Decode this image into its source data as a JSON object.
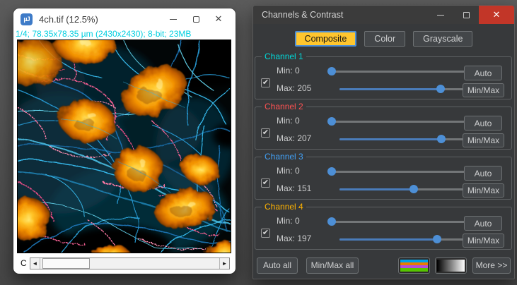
{
  "image_window": {
    "title": "4ch.tif (12.5%)",
    "info_line": "1/4; 78.35x78.35 µm (2430x2430); 8-bit; 23MB",
    "info_color": "#00cfe0",
    "channel_slider": {
      "label": "C",
      "position": "1/4"
    }
  },
  "channels_dialog": {
    "title": "Channels & Contrast",
    "accent_color": "#ffc62e",
    "slider_color": "#4d8fd6",
    "display_modes": [
      {
        "label": "Composite",
        "selected": true
      },
      {
        "label": "Color",
        "selected": false
      },
      {
        "label": "Grayscale",
        "selected": false
      }
    ],
    "channel_buttons": {
      "auto": "Auto",
      "minmax": "Min/Max"
    },
    "channels": [
      {
        "name": "Channel 1",
        "label_color": "#00d9d9",
        "enabled": true,
        "min": 0,
        "max": 205,
        "range": 255,
        "min_label": "Min: 0",
        "max_label": "Max: 205"
      },
      {
        "name": "Channel 2",
        "label_color": "#ff5252",
        "enabled": true,
        "min": 0,
        "max": 207,
        "range": 255,
        "min_label": "Min: 0",
        "max_label": "Max: 207"
      },
      {
        "name": "Channel 3",
        "label_color": "#42a0f5",
        "enabled": true,
        "min": 0,
        "max": 151,
        "range": 255,
        "min_label": "Min: 0",
        "max_label": "Max: 151"
      },
      {
        "name": "Channel 4",
        "label_color": "#ffb300",
        "enabled": true,
        "min": 0,
        "max": 197,
        "range": 255,
        "min_label": "Min: 0",
        "max_label": "Max: 197"
      }
    ],
    "footer": {
      "auto_all": "Auto all",
      "minmax_all": "Min/Max all",
      "more": "More >>",
      "color_lut_stripes": [
        "#00a2e8",
        "#e87d00",
        "#b44fd8",
        "#57c400"
      ]
    }
  }
}
